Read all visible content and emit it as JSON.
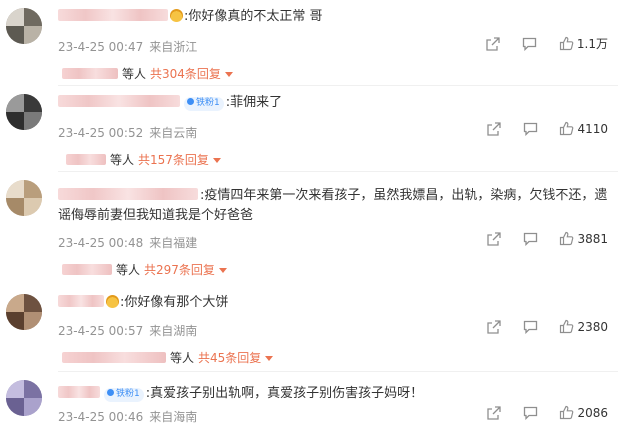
{
  "comments": [
    {
      "text": ":你好像真的不太正常 哥",
      "date": "23-4-25 00:47",
      "location": "来自浙江",
      "likes": "1.1万",
      "reply_people": "等人",
      "reply_count": "共304条回复",
      "badge": "crown-icon"
    },
    {
      "text": ":菲佣来了",
      "date": "23-4-25 00:52",
      "location": "来自云南",
      "likes": "4110",
      "reply_people": "等人",
      "reply_count": "共157条回复",
      "badge": "铁粉1"
    },
    {
      "text": ":疫情四年来第一次来看孩子，虽然我嫖昌，出轨，染病，欠钱不还，遗",
      "text2": "谣侮辱前妻但我知道我是个好爸爸",
      "date": "23-4-25 00:48",
      "location": "来自福建",
      "likes": "3881",
      "reply_people": "等人",
      "reply_count": "共297条回复"
    },
    {
      "text": ":你好像有那个大饼",
      "date": "23-4-25 00:57",
      "location": "来自湖南",
      "likes": "2380",
      "reply_people": "等人",
      "reply_count": "共45条回复",
      "badge": "crown-icon"
    },
    {
      "text": ":真爱孩子别出轨啊，真爱孩子别伤害孩子妈呀！",
      "date": "23-4-25 00:46",
      "location": "来自海南",
      "likes": "2086",
      "badge": "铁粉1"
    }
  ],
  "colors": {
    "accent": "#eb7350",
    "meta": "#939393",
    "fan_badge": "#3e8ff5"
  }
}
